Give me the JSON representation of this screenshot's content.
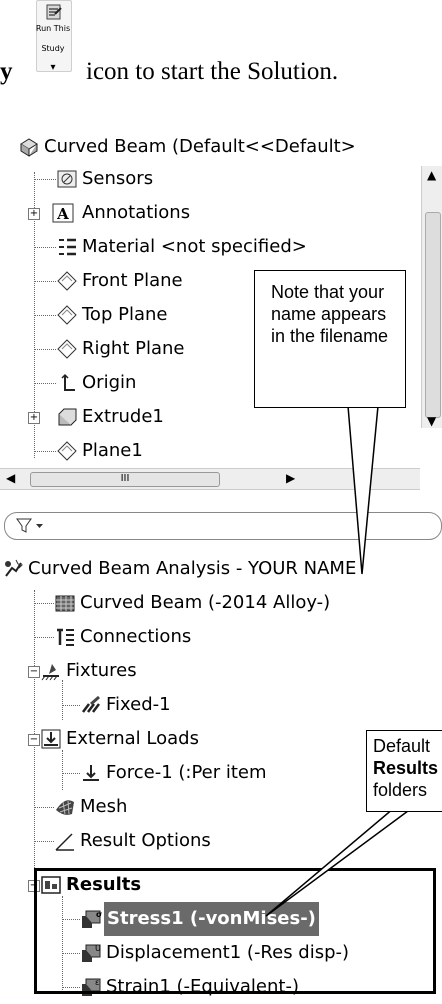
{
  "instruction": {
    "prefix": "y",
    "run_study_label_line1": "Run This",
    "run_study_label_line2": "Study",
    "text": "icon to start the Solution."
  },
  "part_tree": {
    "items": [
      {
        "label": "Curved Beam  (Default<<Default>",
        "icon": "part-icon"
      },
      {
        "label": "Sensors",
        "icon": "sensor-icon"
      },
      {
        "label": "Annotations",
        "icon": "annotation-icon"
      },
      {
        "label": "Material <not specified>",
        "icon": "material-icon"
      },
      {
        "label": "Front Plane",
        "icon": "plane-icon"
      },
      {
        "label": "Top Plane",
        "icon": "plane-icon"
      },
      {
        "label": "Right Plane",
        "icon": "plane-icon"
      },
      {
        "label": "Origin",
        "icon": "origin-icon"
      },
      {
        "label": "Extrude1",
        "icon": "extrude-icon"
      },
      {
        "label": "Plane1",
        "icon": "plane-icon"
      }
    ],
    "hscroll_label": "III"
  },
  "callouts": {
    "name_note": "Note that your name appears in the filename",
    "default_line1": "Default",
    "default_bold": "Results",
    "default_line3": "folders"
  },
  "study_tree": {
    "items": [
      {
        "label": "Curved Beam Analysis - YOUR NAME",
        "icon": "study-icon"
      },
      {
        "label": "Curved Beam (-2014 Alloy-)",
        "icon": "part-mat-icon"
      },
      {
        "label": "Connections",
        "icon": "connections-icon"
      },
      {
        "label": "Fixtures",
        "icon": "fixtures-icon"
      },
      {
        "label": "Fixed-1",
        "icon": "fixed-icon"
      },
      {
        "label": "External Loads",
        "icon": "loads-icon"
      },
      {
        "label": "Force-1 (:Per item",
        "icon": "force-icon"
      },
      {
        "label": "Mesh",
        "icon": "mesh-icon"
      },
      {
        "label": "Result Options",
        "icon": "result-options-icon"
      },
      {
        "label": "Results",
        "icon": "results-folder-icon"
      },
      {
        "label": "Stress1 (-vonMises-)",
        "icon": "stress-icon"
      },
      {
        "label": "Displacement1 (-Res disp-)",
        "icon": "displacement-icon"
      },
      {
        "label": "Strain1 (-Equivalent-)",
        "icon": "strain-icon"
      }
    ]
  }
}
